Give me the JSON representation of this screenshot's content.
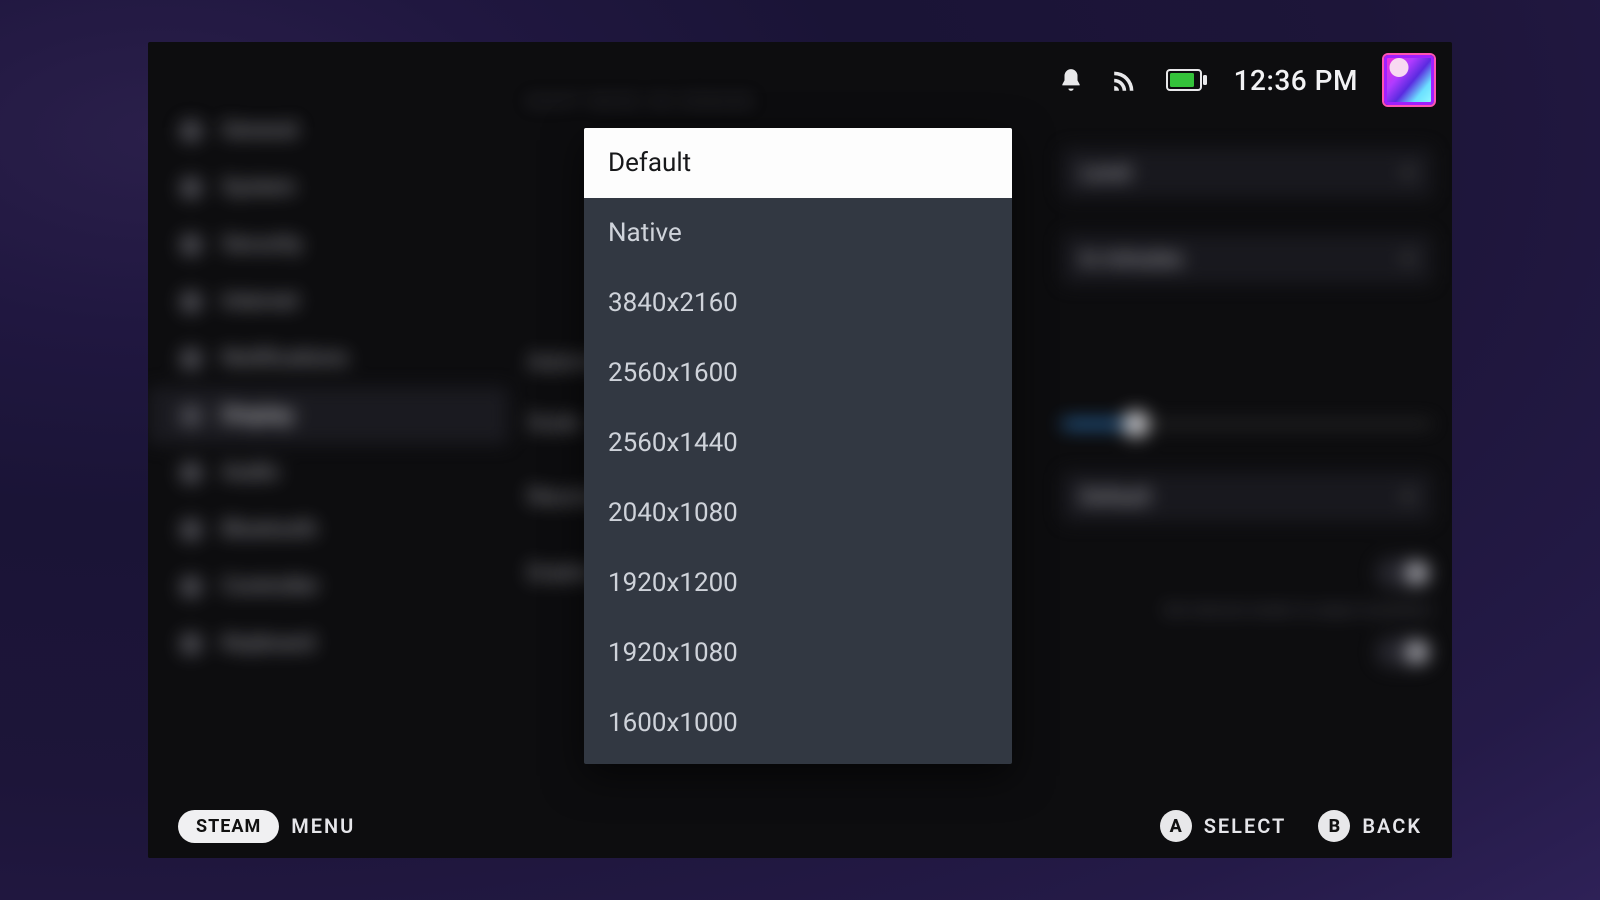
{
  "statusbar": {
    "time": "12:36 PM"
  },
  "sidebar": {
    "items": [
      {
        "label": "General"
      },
      {
        "label": "System"
      },
      {
        "label": "Security"
      },
      {
        "label": "Internet"
      },
      {
        "label": "Notifications"
      },
      {
        "label": "Display"
      },
      {
        "label": "Audio"
      },
      {
        "label": "Bluetooth"
      },
      {
        "label": "Controller"
      },
      {
        "label": "Keyboard"
      }
    ],
    "active_index": 5
  },
  "content": {
    "section_header": "NIGHT MODE ON DEMAND",
    "rows": {
      "r0": {
        "label": "",
        "value": "Level"
      },
      "r1": {
        "label": "",
        "value": "In minutes"
      },
      "r2": {
        "label": "Automatically Scale User Interface",
        "value": ""
      },
      "r3": {
        "label": "Scale",
        "value": ""
      },
      "r4": {
        "label": "Resolution",
        "value": "Default"
      },
      "r5_hint": "Set internal render & output resolution",
      "r6": {
        "label": "Enable",
        "value": ""
      },
      "r7": {
        "label": "",
        "value": ""
      }
    }
  },
  "popup": {
    "options": [
      "Default",
      "Native",
      "3840x2160",
      "2560x1600",
      "2560x1440",
      "2040x1080",
      "1920x1200",
      "1920x1080",
      "1600x1000"
    ],
    "selected_index": 0
  },
  "footer": {
    "pill": "STEAM",
    "menu": "MENU",
    "a_label": "SELECT",
    "b_label": "BACK",
    "a_glyph": "A",
    "b_glyph": "B"
  }
}
